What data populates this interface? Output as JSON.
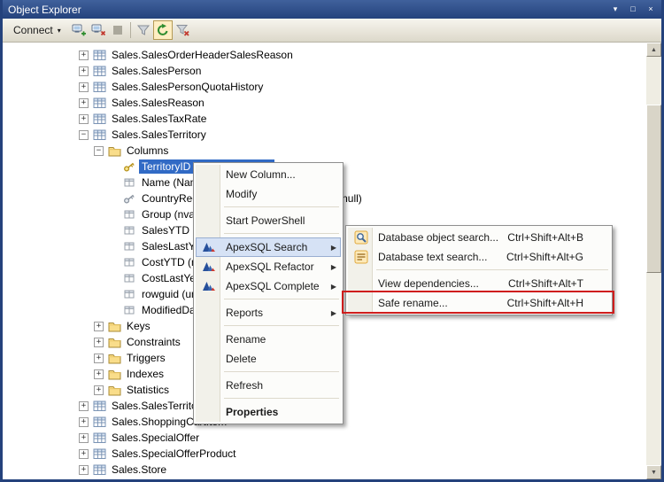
{
  "window": {
    "title": "Object Explorer",
    "buttons": [
      "window-menu",
      "maximize",
      "close"
    ]
  },
  "colors": {
    "titlebar": "#24427c",
    "selection": "#316ac5",
    "annotation": "#cf1d1d",
    "menu_highlight": "#d6e2f5"
  },
  "toolbar": {
    "connect_label": "Connect",
    "icons": [
      "connect",
      "disconnect",
      "stop",
      "separator",
      "filter",
      "refresh",
      "clear-filter"
    ]
  },
  "tree": {
    "rows": [
      {
        "label": "Sales.SalesOrderHeaderSalesReason",
        "level": 0,
        "expand": "plus",
        "icon": "table"
      },
      {
        "label": "Sales.SalesPerson",
        "level": 0,
        "expand": "plus",
        "icon": "table"
      },
      {
        "label": "Sales.SalesPersonQuotaHistory",
        "level": 0,
        "expand": "plus",
        "icon": "table"
      },
      {
        "label": "Sales.SalesReason",
        "level": 0,
        "expand": "plus",
        "icon": "table"
      },
      {
        "label": "Sales.SalesTaxRate",
        "level": 0,
        "expand": "plus",
        "icon": "table"
      },
      {
        "label": "Sales.SalesTerritory",
        "level": 0,
        "expand": "minus",
        "icon": "table"
      },
      {
        "label": "Columns",
        "level": 1,
        "expand": "minus",
        "icon": "folder"
      },
      {
        "label": "TerritoryID (PK, int, not null)",
        "level": 2,
        "expand": "none",
        "icon": "key-gold",
        "selected": true
      },
      {
        "label": "Name (Name(50), not null)",
        "level": 2,
        "expand": "none",
        "icon": "column"
      },
      {
        "label": "CountryRegionCode (FK, nvarchar(3), not null)",
        "level": 2,
        "expand": "none",
        "icon": "key-silver"
      },
      {
        "label": "Group (nvarchar(50), not null)",
        "level": 2,
        "expand": "none",
        "icon": "column"
      },
      {
        "label": "SalesYTD (money, not null)",
        "level": 2,
        "expand": "none",
        "icon": "column"
      },
      {
        "label": "SalesLastYear (money, not null)",
        "level": 2,
        "expand": "none",
        "icon": "column"
      },
      {
        "label": "CostYTD (money, not null)",
        "level": 2,
        "expand": "none",
        "icon": "column"
      },
      {
        "label": "CostLastYear (money, not null)",
        "level": 2,
        "expand": "none",
        "icon": "column"
      },
      {
        "label": "rowguid (uniqueidentifier, not null)",
        "level": 2,
        "expand": "none",
        "icon": "column"
      },
      {
        "label": "ModifiedDate (datetime, not null)",
        "level": 2,
        "expand": "none",
        "icon": "column"
      },
      {
        "label": "Keys",
        "level": 1,
        "expand": "plus",
        "icon": "folder"
      },
      {
        "label": "Constraints",
        "level": 1,
        "expand": "plus",
        "icon": "folder"
      },
      {
        "label": "Triggers",
        "level": 1,
        "expand": "plus",
        "icon": "folder"
      },
      {
        "label": "Indexes",
        "level": 1,
        "expand": "plus",
        "icon": "folder"
      },
      {
        "label": "Statistics",
        "level": 1,
        "expand": "plus",
        "icon": "folder"
      },
      {
        "label": "Sales.SalesTerritoryHistory",
        "level": 0,
        "expand": "plus",
        "icon": "table"
      },
      {
        "label": "Sales.ShoppingCartItem",
        "level": 0,
        "expand": "plus",
        "icon": "table"
      },
      {
        "label": "Sales.SpecialOffer",
        "level": 0,
        "expand": "plus",
        "icon": "table"
      },
      {
        "label": "Sales.SpecialOfferProduct",
        "level": 0,
        "expand": "plus",
        "icon": "table"
      },
      {
        "label": "Sales.Store",
        "level": 0,
        "expand": "plus",
        "icon": "table"
      }
    ]
  },
  "context_menu": {
    "items": [
      {
        "label": "New Column..."
      },
      {
        "label": "Modify"
      },
      {
        "sep": true
      },
      {
        "label": "Start PowerShell"
      },
      {
        "sep": true
      },
      {
        "label": "ApexSQL Search",
        "icon": "apexsql",
        "arrow": true,
        "highlighted": true
      },
      {
        "label": "ApexSQL Refactor",
        "icon": "apexsql",
        "arrow": true
      },
      {
        "label": "ApexSQL Complete",
        "icon": "apexsql",
        "arrow": true
      },
      {
        "sep": true
      },
      {
        "label": "Reports",
        "arrow": true
      },
      {
        "sep": true
      },
      {
        "label": "Rename"
      },
      {
        "label": "Delete"
      },
      {
        "sep": true
      },
      {
        "label": "Refresh"
      },
      {
        "sep": true
      },
      {
        "label": "Properties",
        "bold": true
      }
    ]
  },
  "submenu": {
    "items": [
      {
        "label": "Database object search...",
        "shortcut": "Ctrl+Shift+Alt+B",
        "icon": "object-search"
      },
      {
        "label": "Database text search...",
        "shortcut": "Ctrl+Shift+Alt+G",
        "icon": "text-search"
      },
      {
        "sep": true
      },
      {
        "label": "View dependencies...",
        "shortcut": "Ctrl+Shift+Alt+T"
      },
      {
        "label": "Safe rename...",
        "shortcut": "Ctrl+Shift+Alt+H",
        "annotated": true
      }
    ]
  }
}
